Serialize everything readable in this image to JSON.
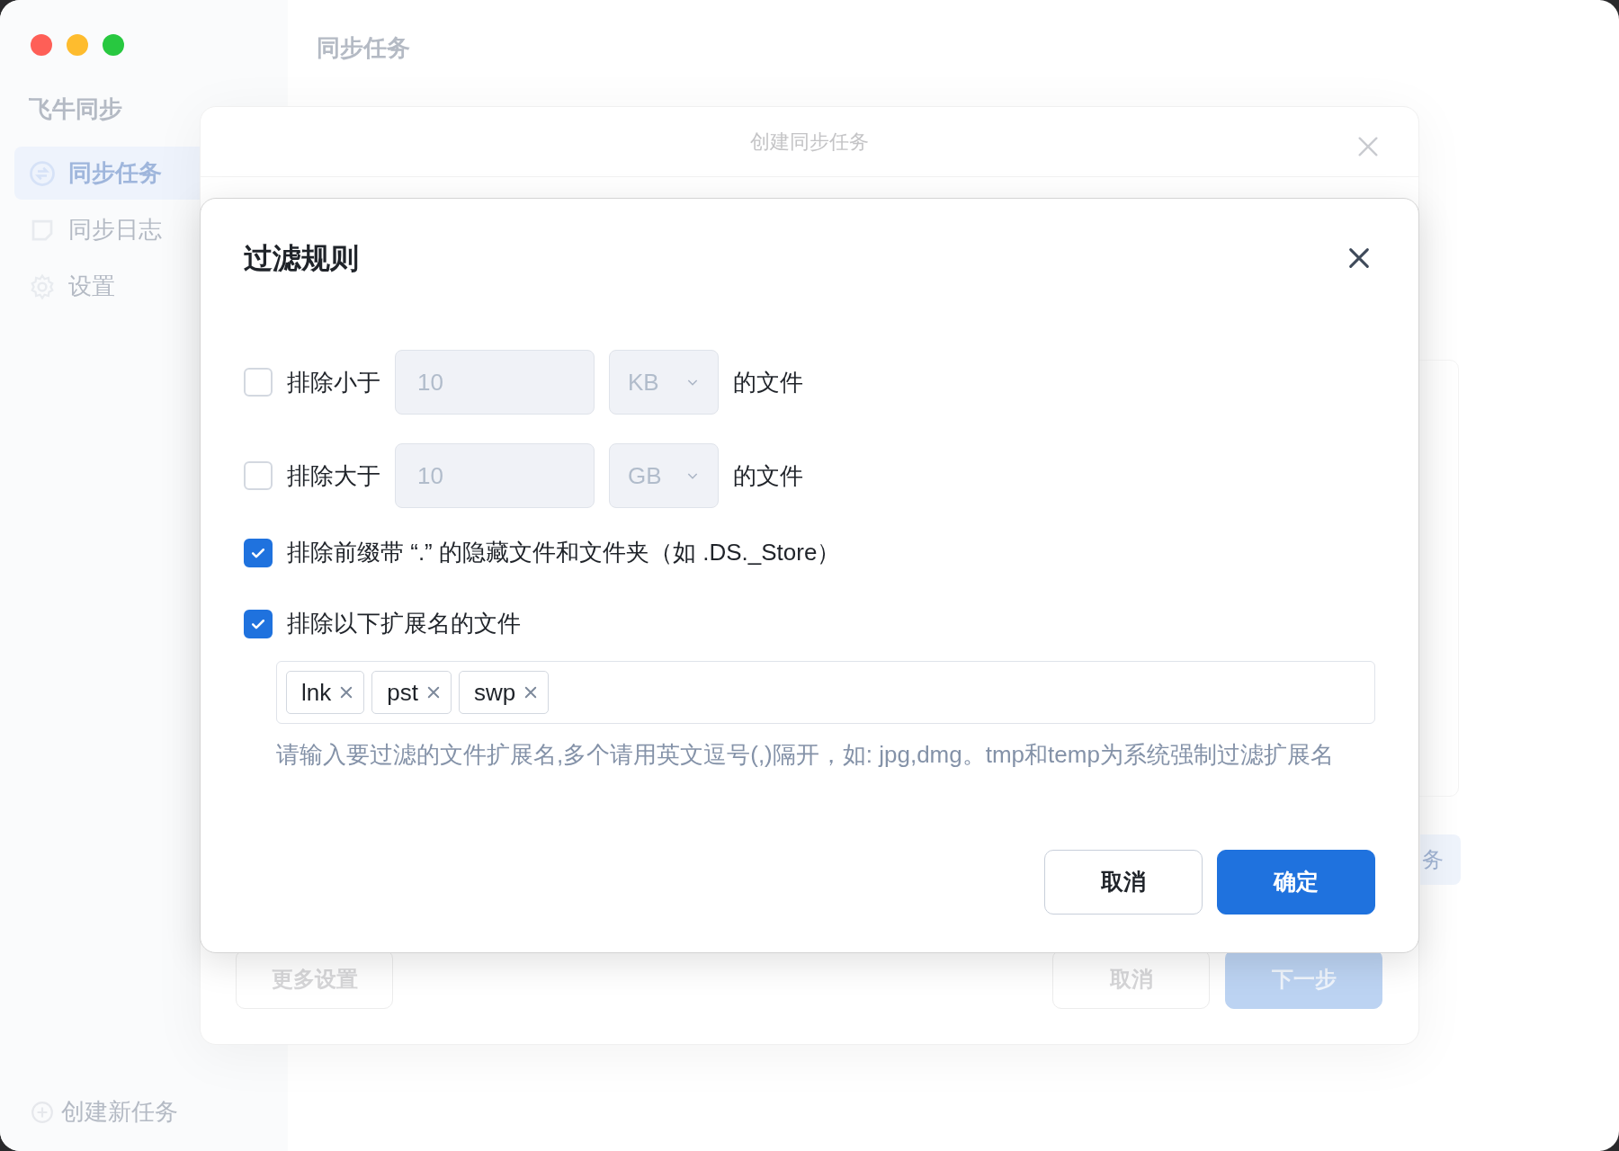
{
  "window": {
    "title": "同步任务"
  },
  "sidebar": {
    "brand": "飞牛同步",
    "items": [
      {
        "label": "同步任务",
        "selected": true
      },
      {
        "label": "同步日志",
        "selected": false
      },
      {
        "label": "设置",
        "selected": false
      }
    ],
    "create_button": "创建新任务"
  },
  "background_dialog": {
    "title": "创建同步任务",
    "partial_button": "务",
    "buttons": [
      {
        "label": "更多设置",
        "kind": "secondary"
      },
      {
        "label": "取消",
        "kind": "secondary"
      },
      {
        "label": "下一步",
        "kind": "primary"
      }
    ]
  },
  "filter_dialog": {
    "title": "过滤规则",
    "rules": [
      {
        "kind": "size",
        "checked": false,
        "label": "排除小于",
        "value": "10",
        "unit": "KB",
        "suffix": "的文件"
      },
      {
        "kind": "size",
        "checked": false,
        "label": "排除大于",
        "value": "10",
        "unit": "GB",
        "suffix": "的文件"
      },
      {
        "kind": "plain",
        "checked": true,
        "label": "排除前缀带 “.” 的隐藏文件和文件夹（如 .DS._Store）"
      },
      {
        "kind": "extensions",
        "checked": true,
        "label": "排除以下扩展名的文件",
        "tags": [
          "lnk",
          "pst",
          "swp"
        ],
        "hint": "请输入要过滤的文件扩展名,多个请用英文逗号(,)隔开，如: jpg,dmg。tmp和temp为系统强制过滤扩展名"
      }
    ],
    "buttons": [
      {
        "label": "取消",
        "kind": "secondary"
      },
      {
        "label": "确定",
        "kind": "primary"
      }
    ]
  }
}
